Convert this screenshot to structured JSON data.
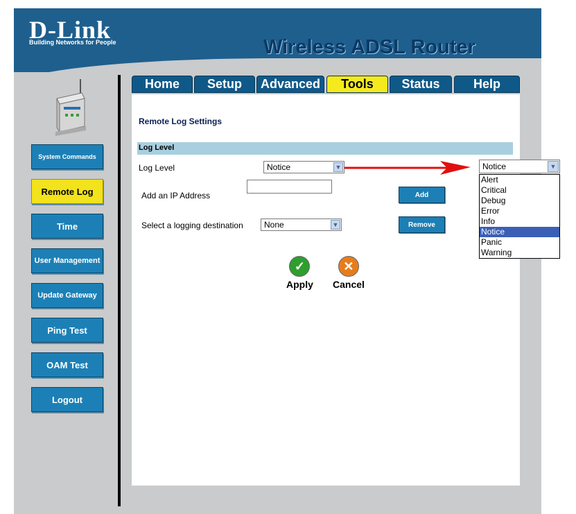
{
  "header": {
    "brand": "D-Link",
    "tagline": "Building Networks for People",
    "product": "Wireless ADSL Router"
  },
  "tabs": [
    {
      "label": "Home"
    },
    {
      "label": "Setup"
    },
    {
      "label": "Advanced"
    },
    {
      "label": "Tools"
    },
    {
      "label": "Status"
    },
    {
      "label": "Help"
    }
  ],
  "active_tab": "Tools",
  "sidebar": {
    "items": [
      {
        "label": "System Commands"
      },
      {
        "label": "Remote Log"
      },
      {
        "label": "Time"
      },
      {
        "label": "User Management"
      },
      {
        "label": "Update Gateway"
      },
      {
        "label": "Ping Test"
      },
      {
        "label": "OAM Test"
      },
      {
        "label": "Logout"
      }
    ],
    "active": "Remote Log"
  },
  "main": {
    "title": "Remote Log Settings",
    "section_header": "Log Level",
    "log_level_label": "Log Level",
    "log_level_value": "Notice",
    "ip_label": "Add an IP Address",
    "ip_value": "",
    "add_button": "Add",
    "destination_label": "Select a logging destination",
    "destination_value": "None",
    "remove_button": "Remove",
    "apply_label": "Apply",
    "cancel_label": "Cancel"
  },
  "dropdown": {
    "value": "Notice",
    "options": [
      "Alert",
      "Critical",
      "Debug",
      "Error",
      "Info",
      "Notice",
      "Panic",
      "Warning"
    ],
    "selected": "Notice"
  },
  "colors": {
    "brand_blue": "#1e5f8e",
    "tab_active": "#f6ea1c",
    "annotation_arrow": "#e01010"
  },
  "icons": {
    "apply": "check-icon",
    "cancel": "x-icon",
    "select": "chevron-down-icon"
  }
}
